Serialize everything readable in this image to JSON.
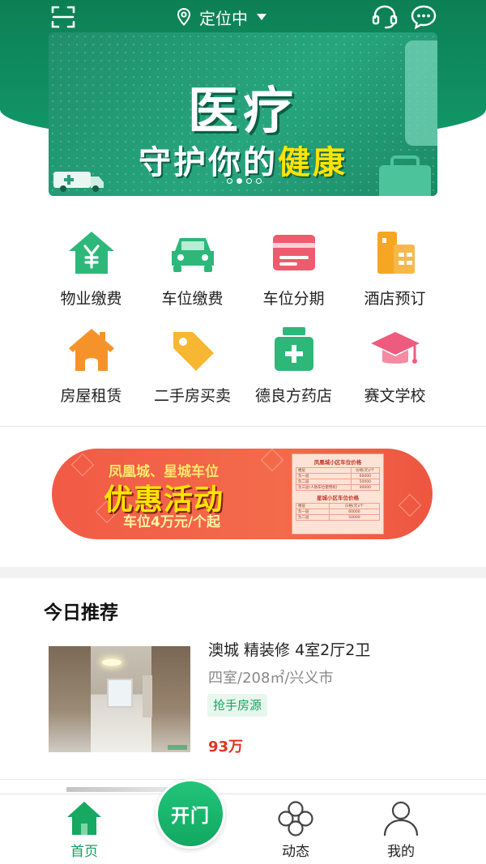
{
  "header": {
    "location_label": "定位中",
    "icons": [
      "scan-icon",
      "location-pin-icon",
      "dropdown-caret-icon",
      "customer-service-icon",
      "chat-icon"
    ],
    "background_color": "#0d7f55"
  },
  "banner": {
    "title": "医疗",
    "subtitle_part1": "守护你的",
    "subtitle_highlight": "健康",
    "dot_count": 4,
    "active_dot": 1
  },
  "services": [
    {
      "label": "物业缴费",
      "icon": "property-fee-icon",
      "color": "#2db87a"
    },
    {
      "label": "车位缴费",
      "icon": "car-icon",
      "color": "#2db87a"
    },
    {
      "label": "车位分期",
      "icon": "card-icon",
      "color": "#ef5b6e"
    },
    {
      "label": "酒店预订",
      "icon": "hotel-icon",
      "color": "#f5a623"
    },
    {
      "label": "房屋租赁",
      "icon": "house-icon",
      "color": "#f5932a"
    },
    {
      "label": "二手房买卖",
      "icon": "tag-icon",
      "color": "#f7b733"
    },
    {
      "label": "德良方药店",
      "icon": "medicine-box-icon",
      "color": "#2db87a"
    },
    {
      "label": "赛文学校",
      "icon": "graduation-cap-icon",
      "color": "#ef5b7e"
    }
  ],
  "promo": {
    "line1": "凤凰城、星城车位",
    "line2": "优惠活动",
    "line3": "车位4万元/个起",
    "table1_title": "凤凰城小区车位价格",
    "table2_title": "星城小区车位价格",
    "col_header_1": "楼层",
    "col_header_2": "价格(元)/个",
    "table1_rows": [
      [
        "负一层",
        "60000"
      ],
      [
        "负二层",
        "50000"
      ],
      [
        "负三层(人防车位使用权)",
        "40000"
      ]
    ],
    "table2_rows": [
      [
        "负一层",
        "60000"
      ],
      [
        "负二层",
        "50000"
      ]
    ]
  },
  "recommend": {
    "title": "今日推荐",
    "listing": {
      "title": "澳城  精装修  4室2厅2卫",
      "sub": "四室/208㎡/兴义市",
      "tag": "抢手房源",
      "price": "93万"
    }
  },
  "tabbar": {
    "home": "首页",
    "open_door": "开门",
    "feed": "动态",
    "mine": "我的",
    "active_color": "#12a05e"
  }
}
